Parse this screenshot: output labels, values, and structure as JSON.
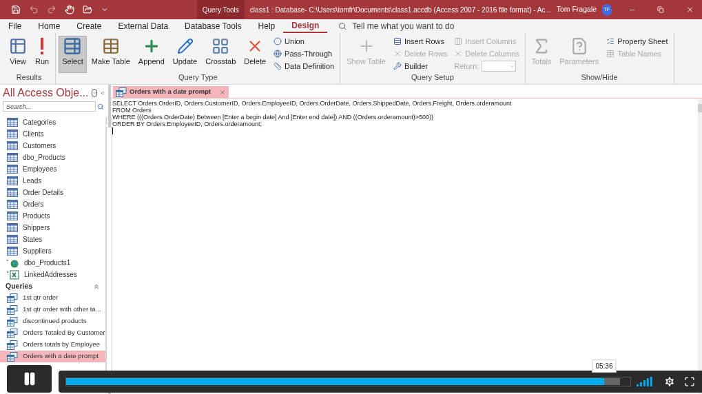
{
  "title_bar": {
    "context_tab": "Query Tools",
    "title": "class1 : Database- C:\\Users\\tomfr\\Documents\\class1.accdb (Access 2007 - 2016 file format)  -  Ac...",
    "user": "Tom Fragale",
    "avatar": "TF"
  },
  "menu_tabs": [
    {
      "label": "File",
      "selected": false
    },
    {
      "label": "Home",
      "selected": false
    },
    {
      "label": "Create",
      "selected": false
    },
    {
      "label": "External Data",
      "selected": false
    },
    {
      "label": "Database Tools",
      "selected": false
    },
    {
      "label": "Help",
      "selected": false
    },
    {
      "label": "Design",
      "selected": true
    }
  ],
  "tell_me": {
    "placeholder": "Tell me what you want to do"
  },
  "ribbon": {
    "groups": [
      {
        "label": "Results",
        "columns": [
          [
            {
              "label": "View",
              "kind": "large",
              "disabled": false,
              "selected": false
            }
          ],
          [
            {
              "label": "Run",
              "kind": "large",
              "disabled": false,
              "selected": false
            }
          ]
        ]
      },
      {
        "label": "Query Type",
        "columns": [
          [
            {
              "label": "Select",
              "kind": "large",
              "disabled": false,
              "selected": true
            }
          ],
          [
            {
              "label": "Make Table",
              "kind": "large",
              "disabled": false,
              "selected": false
            }
          ],
          [
            {
              "label": "Append",
              "kind": "large",
              "disabled": false,
              "selected": false
            }
          ],
          [
            {
              "label": "Update",
              "kind": "large",
              "disabled": false,
              "selected": false
            }
          ],
          [
            {
              "label": "Crosstab",
              "kind": "large",
              "disabled": false,
              "selected": false
            }
          ],
          [
            {
              "label": "Delete",
              "kind": "large",
              "disabled": false,
              "selected": false
            }
          ],
          [
            {
              "label": "Union",
              "kind": "small",
              "disabled": false
            },
            {
              "label": "Pass-Through",
              "kind": "small",
              "disabled": false
            },
            {
              "label": "Data Definition",
              "kind": "small",
              "disabled": false
            }
          ]
        ]
      },
      {
        "label": "Query Setup",
        "columns": [
          [
            {
              "label": "Show Table",
              "kind": "large",
              "disabled": true,
              "selected": false
            }
          ],
          [
            {
              "label": "Insert Rows",
              "kind": "small",
              "disabled": false
            },
            {
              "label": "Delete Rows",
              "kind": "small",
              "disabled": true
            },
            {
              "label": "Builder",
              "kind": "small",
              "disabled": false
            }
          ],
          [
            {
              "label": "Insert Columns",
              "kind": "small",
              "disabled": true
            },
            {
              "label": "Delete Columns",
              "kind": "small",
              "disabled": true
            },
            {
              "label": "Return:",
              "kind": "combo",
              "disabled": true
            }
          ]
        ]
      },
      {
        "label": "Show/Hide",
        "columns": [
          [
            {
              "label": "Totals",
              "kind": "large",
              "disabled": true,
              "selected": false
            }
          ],
          [
            {
              "label": "Parameters",
              "kind": "large",
              "disabled": true,
              "selected": false
            }
          ],
          [
            {
              "label": "Property Sheet",
              "kind": "small",
              "disabled": false
            },
            {
              "label": "Table Names",
              "kind": "small",
              "disabled": true
            }
          ]
        ]
      }
    ]
  },
  "nav_pane": {
    "title": "All Access Obje...",
    "search": {
      "placeholder": "Search..."
    },
    "tables": [
      {
        "label": "Categories",
        "kind": "table"
      },
      {
        "label": "Clients",
        "kind": "table"
      },
      {
        "label": "Customers",
        "kind": "table"
      },
      {
        "label": "dbo_Products",
        "kind": "table"
      },
      {
        "label": "Employees",
        "kind": "table"
      },
      {
        "label": "Leads",
        "kind": "table"
      },
      {
        "label": "Order Details",
        "kind": "table"
      },
      {
        "label": "Orders",
        "kind": "table"
      },
      {
        "label": "Products",
        "kind": "table"
      },
      {
        "label": "Shippers",
        "kind": "table"
      },
      {
        "label": "States",
        "kind": "table"
      },
      {
        "label": "Suppliers",
        "kind": "table"
      },
      {
        "label": "dbo_Products1",
        "kind": "linked_odbc"
      },
      {
        "label": "LinkedAddresses",
        "kind": "linked_excel"
      }
    ],
    "queries": {
      "title": "Queries",
      "expanded": true,
      "items": [
        {
          "label": "1st qtr order",
          "selected": false
        },
        {
          "label": "1st qtr order with other ta...",
          "selected": false
        },
        {
          "label": "discontinued products",
          "selected": false
        },
        {
          "label": "Orders Totaled By Customer",
          "selected": false
        },
        {
          "label": "Orders totals by Employee",
          "selected": false
        },
        {
          "label": "Orders with a date prompt",
          "selected": true
        }
      ]
    }
  },
  "document_tab": {
    "label": "Orders with a date prompt",
    "selected": true
  },
  "sql_lines": [
    "SELECT Orders.OrderID, Orders.CustomerID, Orders.EmployeeID, Orders.OrderDate, Orders.ShippedDate, Orders.Freight, Orders.orderamount",
    "FROM Orders",
    "WHERE (((Orders.OrderDate) Between [Enter a begin date] And [Enter end date]) AND ((Orders.orderamount)>500))",
    "ORDER BY Orders.EmployeeID, Orders.orderamount;"
  ],
  "player": {
    "playing": true,
    "progress": {
      "level": 0.954
    },
    "buffered": {
      "level": 0.982
    },
    "time": "05:36"
  }
}
